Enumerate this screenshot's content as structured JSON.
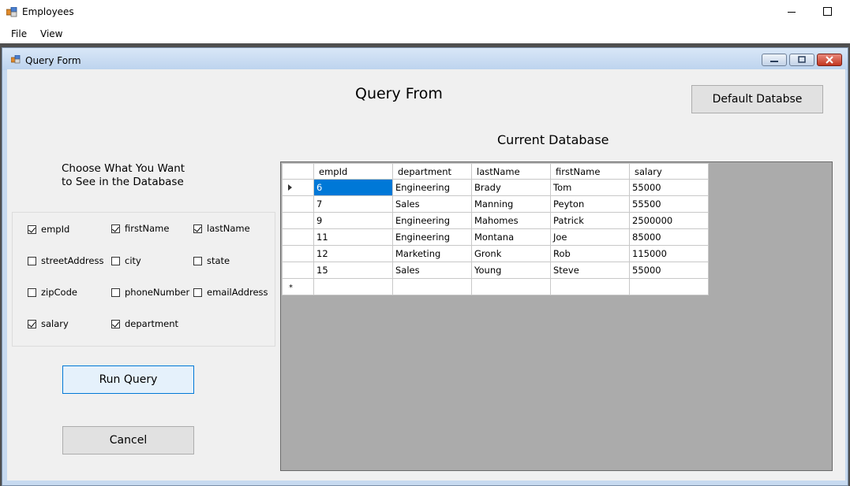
{
  "window": {
    "title": "Employees"
  },
  "menu": [
    "File",
    "View"
  ],
  "child_window": {
    "title": "Query Form"
  },
  "form": {
    "heading": "Query From",
    "default_button": "Default Databse",
    "current_db_label": "Current Database",
    "choose_label": "Choose What You Want\nto See in the Database",
    "run_button": "Run Query",
    "cancel_button": "Cancel"
  },
  "checkboxes": [
    {
      "label": "empId",
      "checked": true
    },
    {
      "label": "firstName",
      "checked": true
    },
    {
      "label": "lastName",
      "checked": true
    },
    {
      "label": "streetAddress",
      "checked": false
    },
    {
      "label": "city",
      "checked": false
    },
    {
      "label": "state",
      "checked": false
    },
    {
      "label": "zipCode",
      "checked": false
    },
    {
      "label": "phoneNumber",
      "checked": false
    },
    {
      "label": "emailAddress",
      "checked": false
    },
    {
      "label": "salary",
      "checked": true
    },
    {
      "label": "department",
      "checked": true
    }
  ],
  "grid": {
    "columns": [
      "empId",
      "department",
      "lastName",
      "firstName",
      "salary"
    ],
    "rows": [
      [
        "6",
        "Engineering",
        "Brady",
        "Tom",
        "55000"
      ],
      [
        "7",
        "Sales",
        "Manning",
        "Peyton",
        "55500"
      ],
      [
        "9",
        "Engineering",
        "Mahomes",
        "Patrick",
        "2500000"
      ],
      [
        "11",
        "Engineering",
        "Montana",
        "Joe",
        "85000"
      ],
      [
        "12",
        "Marketing",
        "Gronk",
        "Rob",
        "115000"
      ],
      [
        "15",
        "Sales",
        "Young",
        "Steve",
        "55000"
      ]
    ],
    "new_row_marker": "*"
  },
  "colors": {
    "selection": "#0078d7",
    "grid_background": "#ababab",
    "form_background": "#f0f0f0"
  }
}
